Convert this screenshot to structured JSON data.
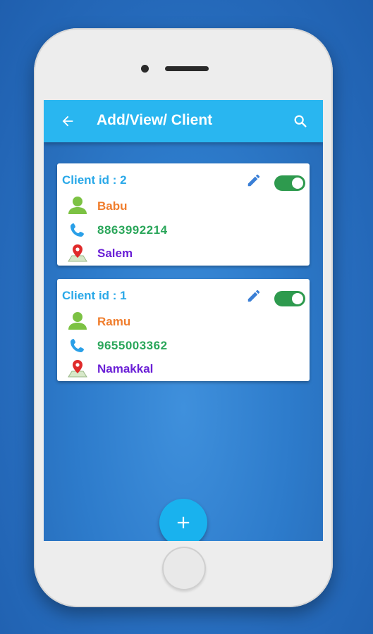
{
  "appbar": {
    "title": "Add/View/ Client",
    "back_icon": "arrow-left-icon",
    "search_icon": "search-icon",
    "color": "#29b6f0"
  },
  "clients": [
    {
      "id_label": "Client id : 2",
      "name": "Babu",
      "phone": "8863992214",
      "location": "Salem",
      "active": true
    },
    {
      "id_label": "Client id : 1",
      "name": "Ramu",
      "phone": "9655003362",
      "location": "Namakkal",
      "active": true
    }
  ],
  "fab": {
    "label": "+",
    "icon": "plus-icon"
  },
  "colors": {
    "id": "#29a8e8",
    "name": "#f07d2c",
    "phone": "#2aa65a",
    "location": "#6a1fd6",
    "toggle_on": "#2e9a4e"
  }
}
